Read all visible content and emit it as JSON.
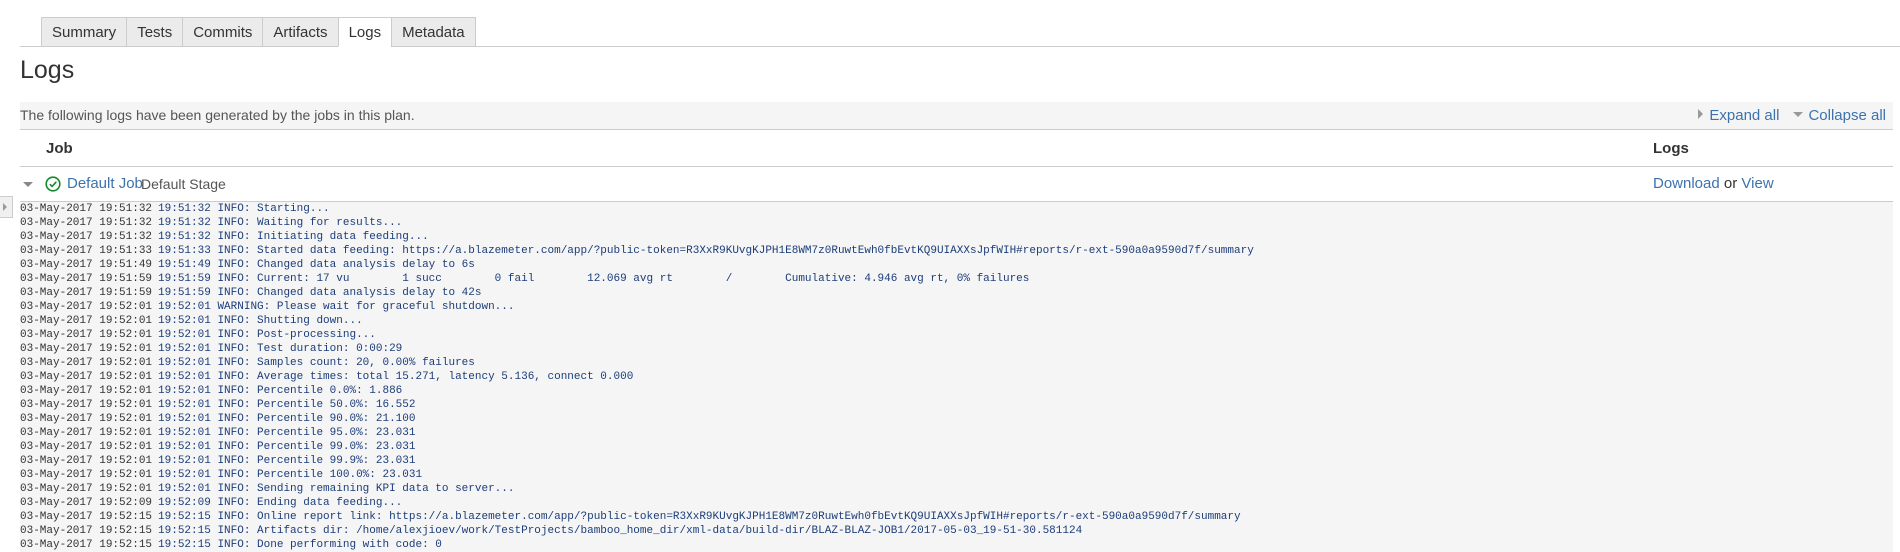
{
  "tabs": [
    {
      "label": "Summary"
    },
    {
      "label": "Tests"
    },
    {
      "label": "Commits"
    },
    {
      "label": "Artifacts"
    },
    {
      "label": "Logs",
      "active": true
    },
    {
      "label": "Metadata"
    }
  ],
  "page": {
    "title": "Logs",
    "description": "The following logs have been generated by the jobs in this plan.",
    "expand_all": "Expand all",
    "collapse_all": "Collapse all"
  },
  "table": {
    "col_job": "Job",
    "col_logs": "Logs"
  },
  "job": {
    "name": "Default Job",
    "stage": "Default Stage",
    "status": "success",
    "download": "Download",
    "or": "or",
    "view": "View"
  },
  "colors": {
    "link": "#3b73af",
    "success": "#14892c",
    "log_text": "#1c3d7a"
  },
  "log_lines": [
    {
      "ts": "03-May-2017 19:51:32",
      "msg": "19:51:32 INFO: Starting..."
    },
    {
      "ts": "03-May-2017 19:51:32",
      "msg": "19:51:32 INFO: Waiting for results..."
    },
    {
      "ts": "03-May-2017 19:51:32",
      "msg": "19:51:32 INFO: Initiating data feeding..."
    },
    {
      "ts": "03-May-2017 19:51:33",
      "msg": "19:51:33 INFO: Started data feeding: https://a.blazemeter.com/app/?public-token=R3XxR9KUvgKJPH1E8WM7z0RuwtEwh0fbEvtKQ9UIAXXsJpfWIH#reports/r-ext-590a0a9590d7f/summary"
    },
    {
      "ts": "03-May-2017 19:51:49",
      "msg": "19:51:49 INFO: Changed data analysis delay to 6s"
    },
    {
      "ts": "03-May-2017 19:51:59",
      "msg": "19:51:59 INFO: Current: 17 vu        1 succ        0 fail        12.069 avg rt        /        Cumulative: 4.946 avg rt, 0% failures"
    },
    {
      "ts": "03-May-2017 19:51:59",
      "msg": "19:51:59 INFO: Changed data analysis delay to 42s"
    },
    {
      "ts": "03-May-2017 19:52:01",
      "msg": "19:52:01 WARNING: Please wait for graceful shutdown..."
    },
    {
      "ts": "03-May-2017 19:52:01",
      "msg": "19:52:01 INFO: Shutting down..."
    },
    {
      "ts": "03-May-2017 19:52:01",
      "msg": "19:52:01 INFO: Post-processing..."
    },
    {
      "ts": "03-May-2017 19:52:01",
      "msg": "19:52:01 INFO: Test duration: 0:00:29"
    },
    {
      "ts": "03-May-2017 19:52:01",
      "msg": "19:52:01 INFO: Samples count: 20, 0.00% failures"
    },
    {
      "ts": "03-May-2017 19:52:01",
      "msg": "19:52:01 INFO: Average times: total 15.271, latency 5.136, connect 0.000"
    },
    {
      "ts": "03-May-2017 19:52:01",
      "msg": "19:52:01 INFO: Percentile 0.0%: 1.886"
    },
    {
      "ts": "03-May-2017 19:52:01",
      "msg": "19:52:01 INFO: Percentile 50.0%: 16.552"
    },
    {
      "ts": "03-May-2017 19:52:01",
      "msg": "19:52:01 INFO: Percentile 90.0%: 21.100"
    },
    {
      "ts": "03-May-2017 19:52:01",
      "msg": "19:52:01 INFO: Percentile 95.0%: 23.031"
    },
    {
      "ts": "03-May-2017 19:52:01",
      "msg": "19:52:01 INFO: Percentile 99.0%: 23.031"
    },
    {
      "ts": "03-May-2017 19:52:01",
      "msg": "19:52:01 INFO: Percentile 99.9%: 23.031"
    },
    {
      "ts": "03-May-2017 19:52:01",
      "msg": "19:52:01 INFO: Percentile 100.0%: 23.031"
    },
    {
      "ts": "03-May-2017 19:52:01",
      "msg": "19:52:01 INFO: Sending remaining KPI data to server..."
    },
    {
      "ts": "03-May-2017 19:52:09",
      "msg": "19:52:09 INFO: Ending data feeding..."
    },
    {
      "ts": "03-May-2017 19:52:15",
      "msg": "19:52:15 INFO: Online report link: https://a.blazemeter.com/app/?public-token=R3XxR9KUvgKJPH1E8WM7z0RuwtEwh0fbEvtKQ9UIAXXsJpfWIH#reports/r-ext-590a0a9590d7f/summary"
    },
    {
      "ts": "03-May-2017 19:52:15",
      "msg": "19:52:15 INFO: Artifacts dir: /home/alexjioev/work/TestProjects/bamboo_home_dir/xml-data/build-dir/BLAZ-BLAZ-JOB1/2017-05-03_19-51-30.581124"
    },
    {
      "ts": "03-May-2017 19:52:15",
      "msg": "19:52:15 INFO: Done performing with code: 0"
    }
  ]
}
